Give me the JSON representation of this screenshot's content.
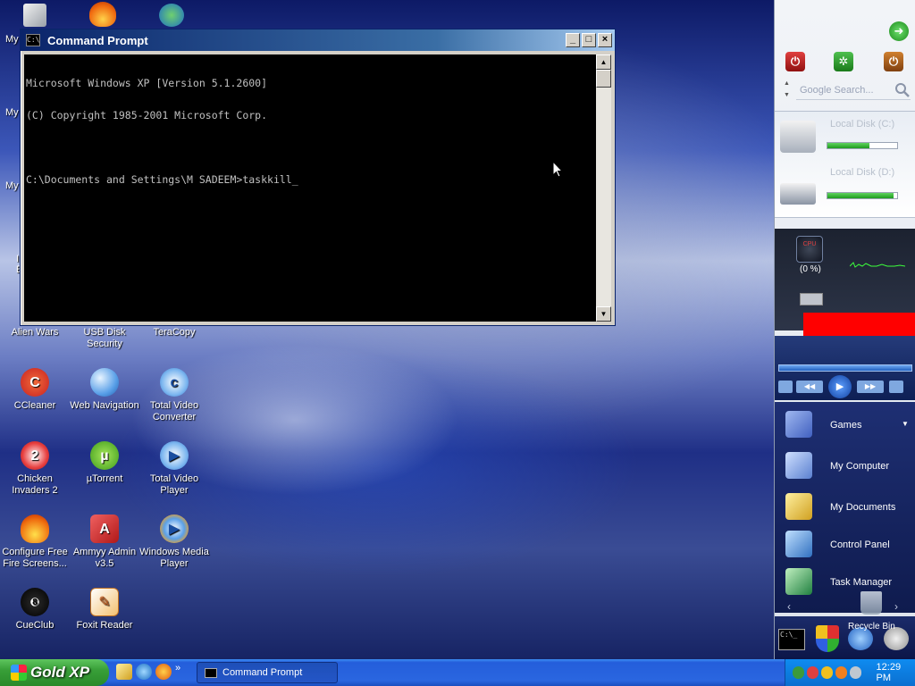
{
  "desktop": {
    "edge_labels": [
      "My",
      "My",
      "My",
      "I",
      "E"
    ],
    "icons": [
      {
        "label": "Alien Wars"
      },
      {
        "label": "USB Disk Security"
      },
      {
        "label": "TeraCopy"
      },
      {
        "label": "CCleaner"
      },
      {
        "label": "Web Navigation"
      },
      {
        "label": "Total Video Converter"
      },
      {
        "label": "Chicken Invaders 2"
      },
      {
        "label": "µTorrent"
      },
      {
        "label": "Total Video Player"
      },
      {
        "label": "Configure Free Fire Screens..."
      },
      {
        "label": "Ammyy Admin v3.5"
      },
      {
        "label": "Windows Media Player"
      },
      {
        "label": "CueClub"
      },
      {
        "label": "Foxit Reader"
      }
    ]
  },
  "cmd_window": {
    "title": "Command Prompt",
    "icon_text": "C:\\",
    "lines": [
      "Microsoft Windows XP [Version 5.1.2600]",
      "(C) Copyright 1985-2001 Microsoft Corp.",
      "",
      "C:\\Documents and Settings\\M SADEEM>taskkill_"
    ],
    "btn_minimize": "_",
    "btn_maximize": "□",
    "btn_close": "×"
  },
  "sidebar": {
    "search_placeholder": "Google Search...",
    "disks": [
      {
        "label": "Local Disk (C:)",
        "used": 0.6
      },
      {
        "label": "Local Disk (D:)",
        "used": 0.95
      }
    ],
    "cpu": {
      "icon_text": "CPU",
      "percent_text": "(0 %)"
    },
    "menu": [
      {
        "label": "Games",
        "color": "#6c88d8"
      },
      {
        "label": "My Computer",
        "color": "#9bb6e8"
      },
      {
        "label": "My Documents",
        "color": "#e3c35a"
      },
      {
        "label": "Control Panel",
        "color": "#6fa3d8"
      },
      {
        "label": "Task Manager",
        "color": "#4f8f5f"
      }
    ],
    "recycle_label": "Recycle Bin"
  },
  "taskbar": {
    "start_label": "Gold XP",
    "task_label": "Command Prompt",
    "clock": "12:29 PM",
    "quick_more": "»"
  },
  "colors": {
    "cmd_text": "#c0c0c0",
    "title_blue": "#0a246a",
    "start_green": "#389f38"
  }
}
